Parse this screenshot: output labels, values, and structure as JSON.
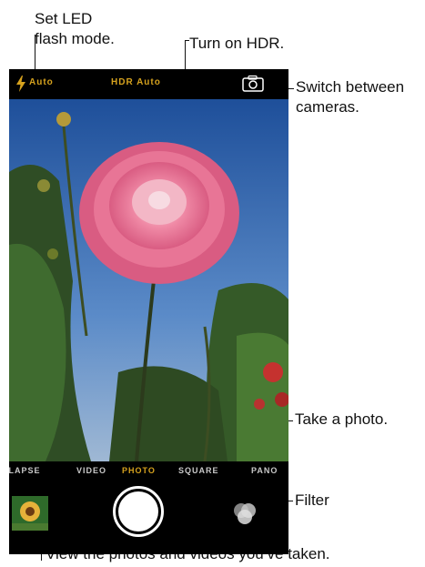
{
  "callouts": {
    "flash_line1": "Set LED",
    "flash_line2": "flash mode.",
    "hdr": "Turn on HDR.",
    "switch_line1": "Switch between",
    "switch_line2": "cameras.",
    "take_photo": "Take a photo.",
    "filter": "Filter",
    "view_photos": "View the photos and videos you’ve taken."
  },
  "camera": {
    "flash": {
      "icon": "lightning-icon",
      "label": "Auto"
    },
    "hdr": {
      "label": "HDR Auto"
    },
    "switch_icon": "camera-switch-icon",
    "modes": [
      "TIME-LAPSE",
      "VIDEO",
      "PHOTO",
      "SQUARE",
      "PANO"
    ],
    "selected_mode": "PHOTO",
    "accent_color": "#d6a21e",
    "shutter_icon": "shutter-button",
    "filter_icon": "filter-circles-icon",
    "thumbnail_icon": "photo-thumbnail"
  }
}
